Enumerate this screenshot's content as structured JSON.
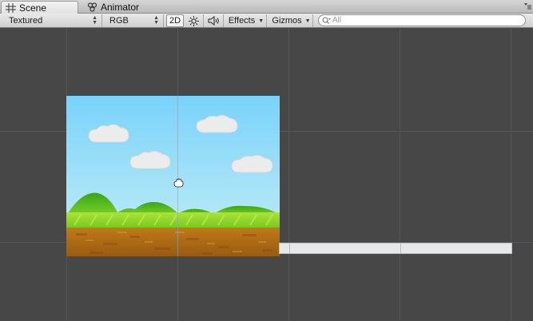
{
  "tabs": [
    {
      "label": "Scene",
      "icon": "grid-icon",
      "active": true
    },
    {
      "label": "Animator",
      "icon": "animator-icon",
      "active": false
    }
  ],
  "toolbar": {
    "render_mode": "Textured",
    "color_mode": "RGB",
    "mode_2d_label": "2D",
    "lighting_icon": "sun-icon",
    "audio_icon": "speaker-icon",
    "effects_label": "Effects",
    "gizmos_label": "Gizmos",
    "search_placeholder": "All"
  },
  "scene": {
    "background_color": "#474747",
    "grid_color": "#555555"
  }
}
